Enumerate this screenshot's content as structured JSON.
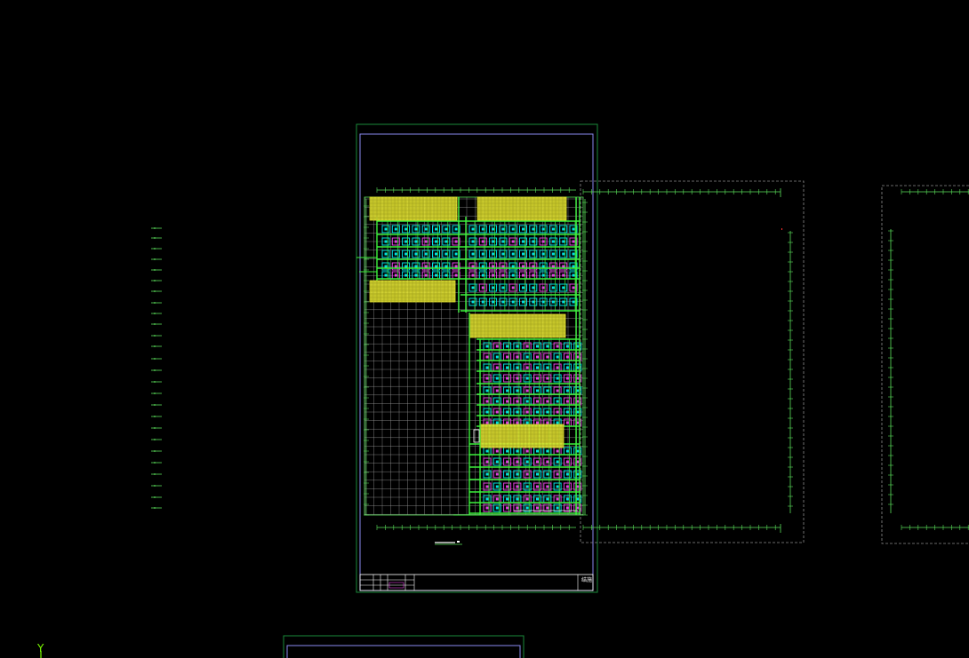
{
  "app": {
    "view": "CAD model space"
  },
  "ucs": {
    "axis_label": "Y",
    "color": "#7CFC00"
  },
  "colors": {
    "background": "#000000",
    "sheet_border": "#1a8a3a",
    "inner_frame": "#8a8af0",
    "grid": "#9a9a9a",
    "beam_green": "#3cf03c",
    "column_cyan": "#00e0e0",
    "column_magenta": "#e040e0",
    "hatch_yellow": "#e8e830",
    "dashed_outline": "#8a8a8a",
    "dim_green": "#5adf5a"
  },
  "title_block": {
    "sheet_no": "结施"
  },
  "drawing_caption": {
    "text": ""
  }
}
